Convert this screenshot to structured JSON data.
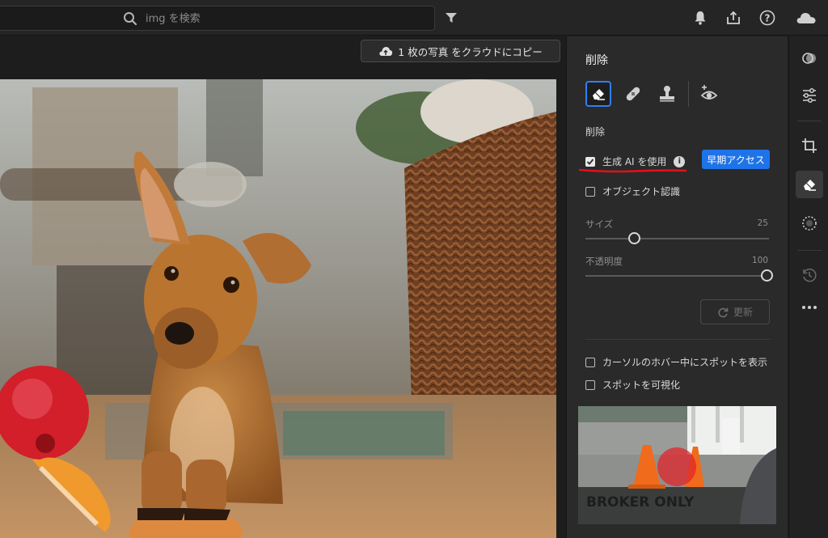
{
  "topbar": {
    "search_placeholder": "img を検索"
  },
  "canvas": {
    "copy_button_label": "1 枚の写真 をクラウドにコピー"
  },
  "panel": {
    "title": "削除",
    "section_label": "削除",
    "generative_ai_label": "生成 AI を使用",
    "generative_ai_checked": true,
    "early_access_label": "早期アクセス",
    "object_detection_label": "オブジェクト認識",
    "object_detection_checked": false,
    "size_label": "サイズ",
    "size_value": "25",
    "opacity_label": "不透明度",
    "opacity_value": "100",
    "refresh_label": "更新",
    "show_spot_label": "カーソルのホバー中にスポットを表示",
    "visualize_spots_label": "スポットを可視化",
    "thumbnail_text": "BROKER ONLY"
  },
  "colors": {
    "accent": "#1f73e8",
    "active_tool_border": "#2f7ff6",
    "underline": "#e3101a"
  }
}
